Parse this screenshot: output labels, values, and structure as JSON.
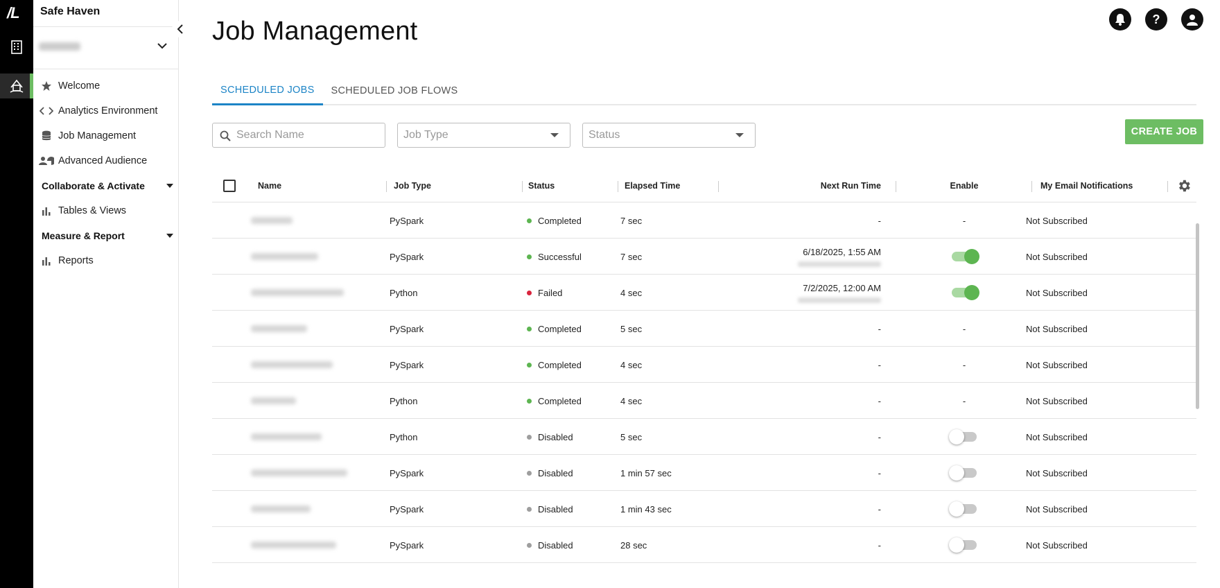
{
  "rail": {
    "logo": "/L",
    "items": [
      {
        "icon": "building-icon"
      },
      {
        "icon": "safe-haven-icon",
        "active": true
      }
    ]
  },
  "sidebar": {
    "app_title": "Safe Haven",
    "nav": [
      {
        "label": "Welcome",
        "icon": "star-icon"
      },
      {
        "label": "Analytics Environment",
        "icon": "code-icon"
      },
      {
        "label": "Job Management",
        "icon": "database-icon"
      },
      {
        "label": "Advanced Audience",
        "icon": "audience-icon"
      }
    ],
    "sections": [
      {
        "label": "Collaborate & Activate",
        "items": [
          {
            "label": "Tables & Views",
            "icon": "bar-chart-icon"
          }
        ]
      },
      {
        "label": "Measure & Report",
        "items": [
          {
            "label": "Reports",
            "icon": "bar-chart-icon"
          }
        ]
      }
    ]
  },
  "header": {
    "title": "Job Management",
    "icons": [
      "bell-icon",
      "help-icon",
      "account-icon"
    ],
    "help_glyph": "?"
  },
  "tabs": [
    {
      "label": "SCHEDULED JOBS",
      "active": true
    },
    {
      "label": "SCHEDULED JOB FLOWS",
      "active": false
    }
  ],
  "filters": {
    "search_placeholder": "Search Name",
    "job_type_placeholder": "Job Type",
    "status_placeholder": "Status"
  },
  "create_button": "CREATE JOB",
  "table": {
    "columns": [
      "Name",
      "Job Type",
      "Status",
      "Elapsed Time",
      "Next Run Time",
      "Enable",
      "My Email Notifications"
    ],
    "rows": [
      {
        "job_type": "PySpark",
        "status": "Completed",
        "status_color": "#5db551",
        "elapsed": "7 sec",
        "next_run": "-",
        "enable": "-",
        "email": "Not Subscribed"
      },
      {
        "job_type": "PySpark",
        "status": "Successful",
        "status_color": "#5db551",
        "elapsed": "7 sec",
        "next_run": "6/18/2025, 1:55 AM",
        "enable": "on",
        "email": "Not Subscribed"
      },
      {
        "job_type": "Python",
        "status": "Failed",
        "status_color": "#d9243d",
        "elapsed": "4 sec",
        "next_run": "7/2/2025, 12:00 AM",
        "enable": "on",
        "email": "Not Subscribed"
      },
      {
        "job_type": "PySpark",
        "status": "Completed",
        "status_color": "#5db551",
        "elapsed": "5 sec",
        "next_run": "-",
        "enable": "-",
        "email": "Not Subscribed"
      },
      {
        "job_type": "PySpark",
        "status": "Completed",
        "status_color": "#5db551",
        "elapsed": "4 sec",
        "next_run": "-",
        "enable": "-",
        "email": "Not Subscribed"
      },
      {
        "job_type": "Python",
        "status": "Completed",
        "status_color": "#5db551",
        "elapsed": "4 sec",
        "next_run": "-",
        "enable": "-",
        "email": "Not Subscribed"
      },
      {
        "job_type": "Python",
        "status": "Disabled",
        "status_color": "#9e9e9e",
        "elapsed": "5 sec",
        "next_run": "-",
        "enable": "off",
        "email": "Not Subscribed"
      },
      {
        "job_type": "PySpark",
        "status": "Disabled",
        "status_color": "#9e9e9e",
        "elapsed": "1 min 57 sec",
        "next_run": "-",
        "enable": "off",
        "email": "Not Subscribed"
      },
      {
        "job_type": "PySpark",
        "status": "Disabled",
        "status_color": "#9e9e9e",
        "elapsed": "1 min 43 sec",
        "next_run": "-",
        "enable": "off",
        "email": "Not Subscribed"
      },
      {
        "job_type": "PySpark",
        "status": "Disabled",
        "status_color": "#9e9e9e",
        "elapsed": "28 sec",
        "next_run": "-",
        "enable": "off",
        "email": "Not Subscribed"
      }
    ]
  }
}
